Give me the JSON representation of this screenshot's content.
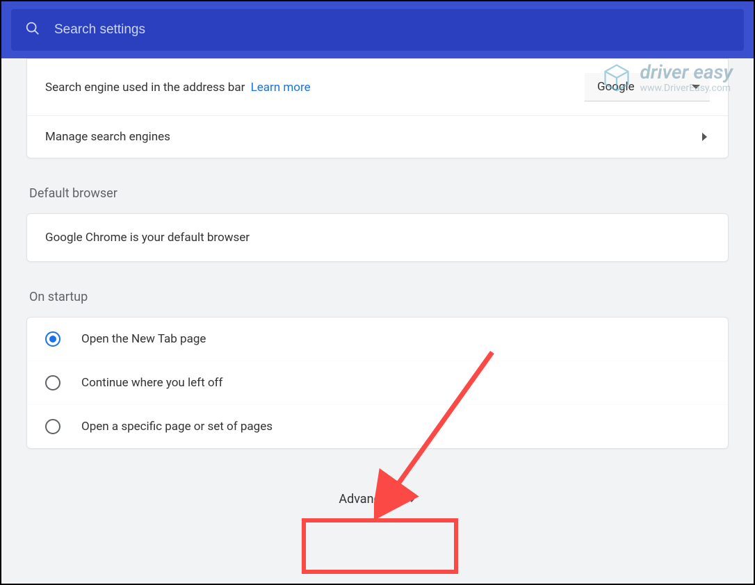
{
  "search": {
    "placeholder": "Search settings"
  },
  "searchEngine": {
    "label": "Search engine used in the address bar",
    "learnMore": "Learn more",
    "selected": "Google",
    "manage": "Manage search engines"
  },
  "defaultBrowser": {
    "heading": "Default browser",
    "text": "Google Chrome is your default browser"
  },
  "onStartup": {
    "heading": "On startup",
    "options": [
      {
        "label": "Open the New Tab page",
        "checked": true
      },
      {
        "label": "Continue where you left off",
        "checked": false
      },
      {
        "label": "Open a specific page or set of pages",
        "checked": false
      }
    ]
  },
  "advanced": {
    "label": "Advanced"
  },
  "watermark": {
    "line1": "driver easy",
    "line2": "www.DriverEasy.com"
  }
}
